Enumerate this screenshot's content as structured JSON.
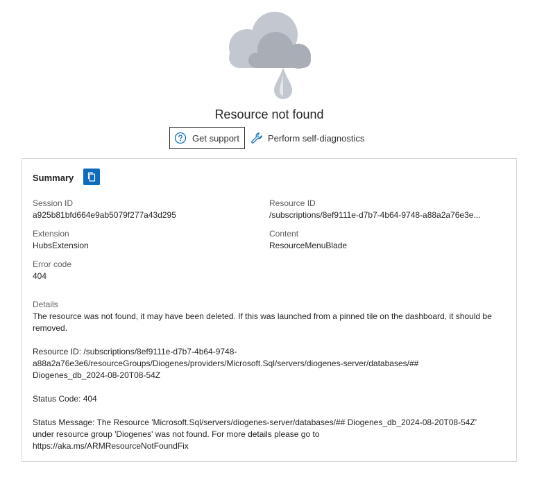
{
  "page": {
    "title": "Resource not found"
  },
  "actions": {
    "support_label": "Get support",
    "diagnostics_label": "Perform self-diagnostics"
  },
  "summary": {
    "title": "Summary",
    "session_id_label": "Session ID",
    "session_id": "a925b81bfd664e9ab5079f277a43d295",
    "resource_id_label": "Resource ID",
    "resource_id": "/subscriptions/8ef9111e-d7b7-4b64-9748-a88a2a76e3e...",
    "extension_label": "Extension",
    "extension": "HubsExtension",
    "content_label": "Content",
    "content": "ResourceMenuBlade",
    "error_code_label": "Error code",
    "error_code": "404"
  },
  "details": {
    "label": "Details",
    "message": "The resource was not found, it may have been deleted. If this was launched from a pinned tile on the dashboard, it should be removed.",
    "resource_id_line1": "Resource ID: /subscriptions/8ef9111e-d7b7-4b64-9748-",
    "resource_id_line2": "a88a2a76e3e6/resourceGroups/Diogenes/providers/Microsoft.Sql/servers/diogenes-server/databases/##",
    "resource_id_line3": "Diogenes_db_2024-08-20T08-54Z",
    "status_code": "Status Code: 404",
    "status_message_line1": "Status Message: The Resource 'Microsoft.Sql/servers/diogenes-server/databases/## Diogenes_db_2024-08-20T08-54Z'",
    "status_message_line2": "under resource group 'Diogenes' was not found. For more details please go to",
    "status_message_line3": "https://aka.ms/ARMResourceNotFoundFix"
  },
  "icons": {
    "illustration": "cloud-rain-icon",
    "support": "question-circle-icon",
    "diagnostics": "wrench-icon",
    "copy": "copy-icon"
  },
  "colors": {
    "accent": "#0f6cbd",
    "cloud_back": "#c3c7cf",
    "cloud_front": "#9ea3ad",
    "drop": "#b7bcc4"
  }
}
